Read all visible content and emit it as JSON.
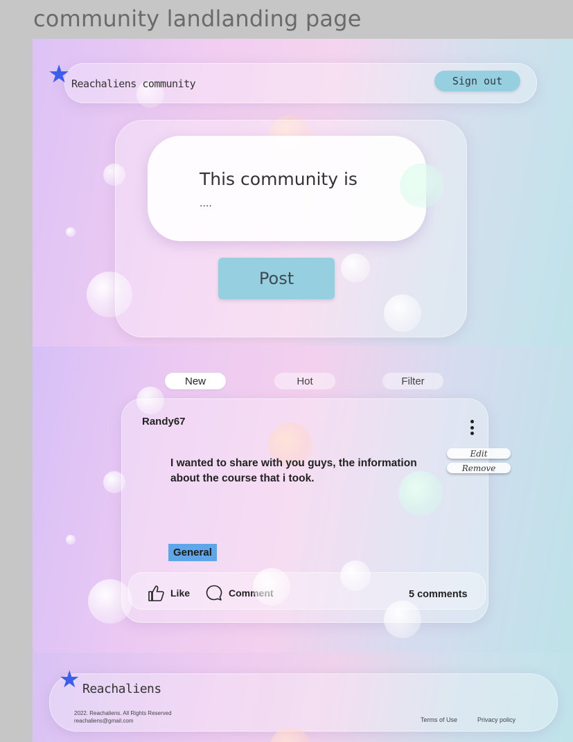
{
  "page_title": "community landlanding page",
  "header": {
    "brand": "Reachaliens community",
    "sign_out_label": "Sign out"
  },
  "compose": {
    "prompt_text": "This community is",
    "ellipsis": "....",
    "post_label": "Post"
  },
  "feed": {
    "tabs": [
      {
        "label": "New",
        "active": true
      },
      {
        "label": "Hot",
        "active": false
      },
      {
        "label": "Filter",
        "active": false
      }
    ],
    "post": {
      "author": "Randy67",
      "body": "I wanted to share with you guys, the information about the course that i took.",
      "tag": "General",
      "menu": {
        "edit": "Edit",
        "remove": "Remove"
      },
      "like_label": "Like",
      "comment_label": "Comment",
      "comment_count": "5 comments"
    }
  },
  "footer": {
    "brand": "Reachaliens",
    "copyright": "2022. Reachaliens. All Rights Reserved",
    "email": "reachaliens@gmail.com",
    "terms_label": "Terms of Use",
    "privacy_label": "Privacy policy"
  },
  "colors": {
    "accent_button": "#96cfe0",
    "star": "#3d5ee8",
    "tag_background": "#5ea6e8"
  }
}
